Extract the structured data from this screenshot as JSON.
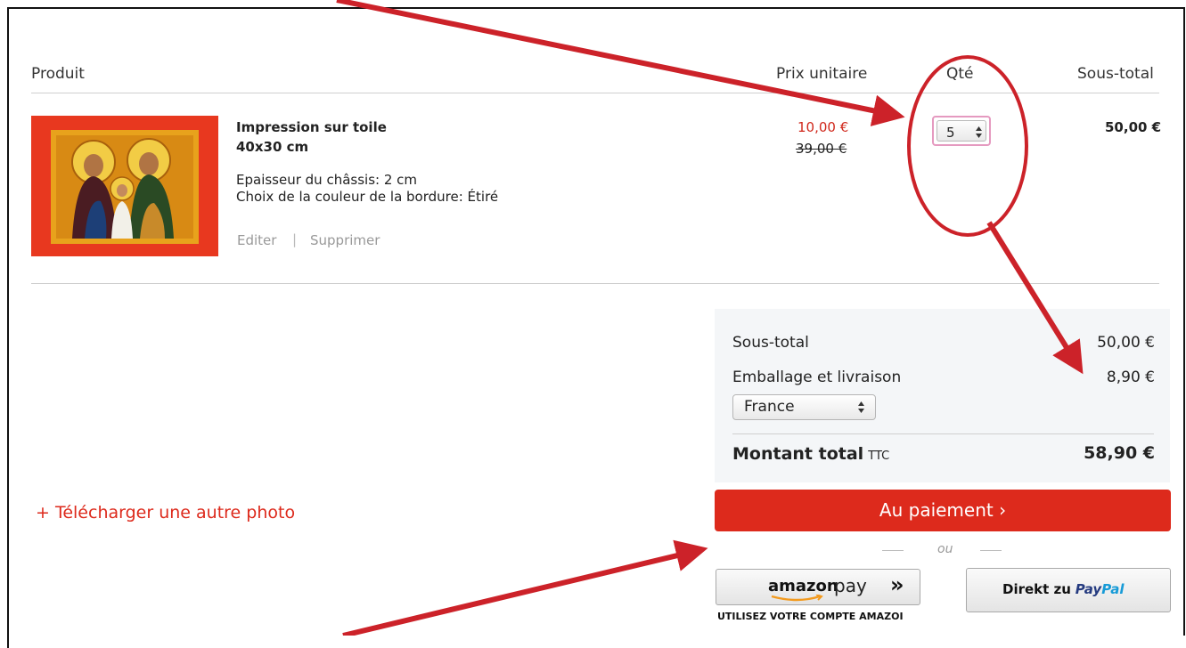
{
  "table": {
    "headers": {
      "product": "Produit",
      "unit_price": "Prix unitaire",
      "qty": "Qté",
      "subtotal": "Sous-total"
    }
  },
  "item": {
    "name": "Impression sur toile",
    "size": "40x30 cm",
    "option1": "Epaisseur du châssis: 2 cm",
    "option2": "Choix de la couleur de la bordure: Étiré",
    "edit": "Editer",
    "separator": "|",
    "delete": "Supprimer",
    "price_new": "10,00 €",
    "price_old": "39,00 €",
    "qty": "5",
    "subtotal": "50,00 €"
  },
  "summary": {
    "subtotal_label": "Sous-total",
    "subtotal_value": "50,00 €",
    "shipping_label": "Emballage et livraison",
    "shipping_value": "8,90 €",
    "country": "France",
    "total_label": "Montant total",
    "total_suffix": "TTC",
    "total_value": "58,90 €"
  },
  "upload_link": "+ Télécharger une autre photo",
  "checkout_label": "Au paiement ›",
  "or_label": "ou",
  "amazon": {
    "brand": "amazon",
    "pay": "pay",
    "chevrons": "»",
    "caption": "UTILISEZ VOTRE COMPTE AMAZOI"
  },
  "paypal": {
    "prefix": "Direkt zu",
    "pay": "Pay",
    "pal": "Pal"
  },
  "colors": {
    "accent": "#dd2a1c",
    "price_red": "#d0281c",
    "arrow": "#cc2229",
    "paypal_dark": "#253b80",
    "paypal_light": "#179bd7"
  }
}
